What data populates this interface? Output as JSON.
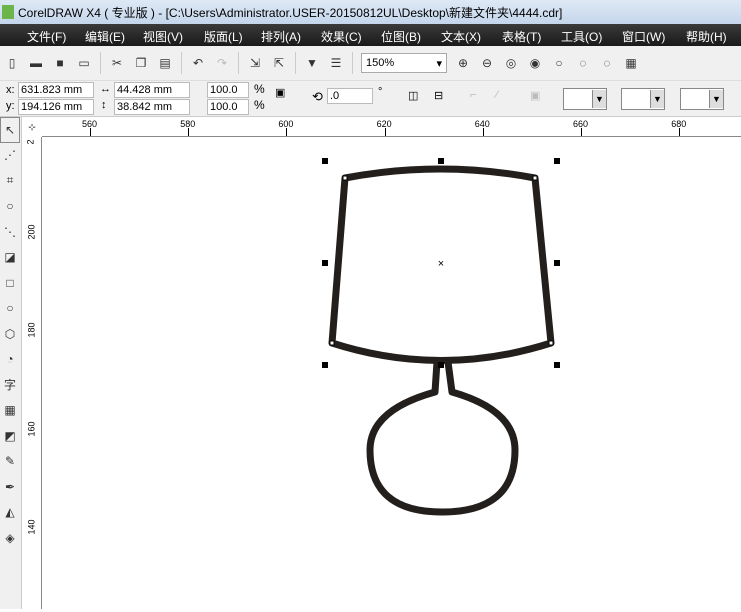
{
  "window": {
    "title": "CorelDRAW X4 ( 专业版 ) - [C:\\Users\\Administrator.USER-20150812UL\\Desktop\\新建文件夹\\4444.cdr]"
  },
  "menu": [
    "文件(F)",
    "编辑(E)",
    "视图(V)",
    "版面(L)",
    "排列(A)",
    "效果(C)",
    "位图(B)",
    "文本(X)",
    "表格(T)",
    "工具(O)",
    "窗口(W)",
    "帮助(H)"
  ],
  "toolbar": {
    "zoom_level": "150%"
  },
  "property_bar": {
    "x_label": "x:",
    "x_value": "631.823 mm",
    "y_label": "y:",
    "y_value": "194.126 mm",
    "width_value": "44.428 mm",
    "height_value": "38.842 mm",
    "scale_x": "100.0",
    "scale_y": "100.0",
    "percent": "%",
    "rotation": ".0",
    "degree": "°"
  },
  "rulers": {
    "horizontal": [
      "560",
      "580",
      "600",
      "620",
      "640",
      "660",
      "680"
    ],
    "vertical": [
      "200",
      "180",
      "160",
      "140"
    ],
    "vertical_top": "2"
  },
  "tools": [
    "pick",
    "shape",
    "crop",
    "zoom",
    "freehand",
    "smart-fill",
    "rectangle",
    "ellipse",
    "polygon",
    "basic-shapes",
    "text",
    "table",
    "interactive-blend",
    "eyedropper",
    "outline",
    "fill",
    "interactive-fill"
  ],
  "colors": {
    "stroke": "#231f1c",
    "menubar": "#222222"
  }
}
